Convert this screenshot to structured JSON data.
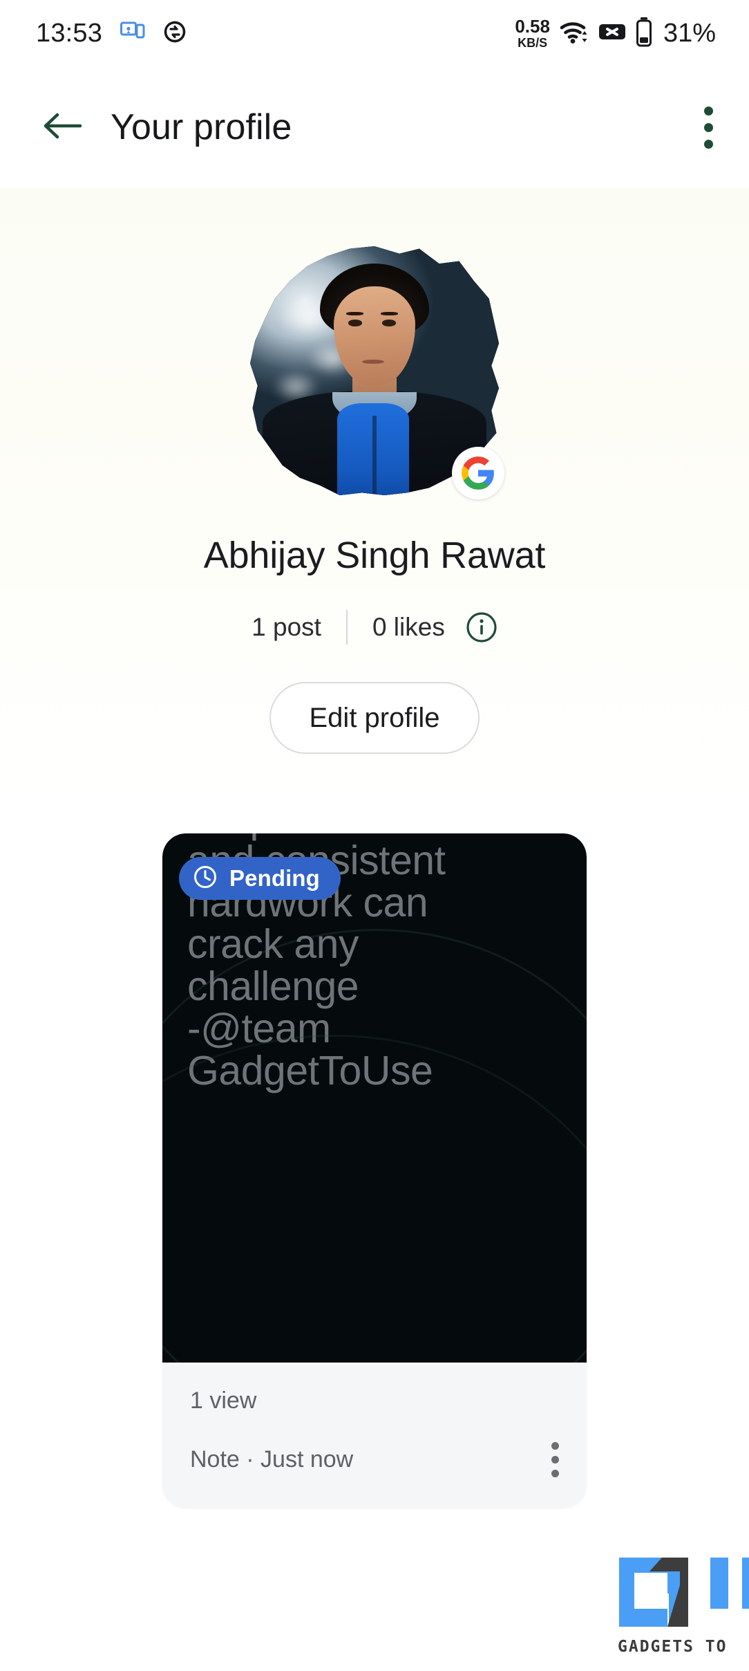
{
  "statusbar": {
    "time": "13:53",
    "icons_left": [
      "cast-screen-icon",
      "sync-icon"
    ],
    "network_speed_value": "0.58",
    "network_speed_unit": "KB/S",
    "icons_right": [
      "wifi-icon",
      "no-signal-icon",
      "battery-icon"
    ],
    "battery_percent": "31%"
  },
  "appbar": {
    "back_icon": "back-arrow-icon",
    "title": "Your profile",
    "overflow_icon": "more-vert-icon",
    "accent_color": "#1e4c36"
  },
  "profile": {
    "avatar_alt": "profile-photo",
    "account_badge": "google-g-icon",
    "name": "Abhijay Singh Rawat",
    "posts": "1 post",
    "likes": "0 likes",
    "info_icon": "info-circle-icon",
    "edit_button": "Edit profile"
  },
  "post": {
    "status_badge": {
      "label": "Pending",
      "icon": "clock-icon",
      "color": "#3264c8"
    },
    "text": "Proper research\nand consistent\nhardwork can\ncrack any\nchallenge\n-@team\nGadgetToUse",
    "views": "1 view",
    "meta": "Note · Just now",
    "overflow_icon": "more-vert-icon"
  },
  "watermark": {
    "brand": "GADGETS TO",
    "logo_colors": {
      "blue": "#4a9ef5",
      "dark": "#3d3d3d"
    }
  }
}
